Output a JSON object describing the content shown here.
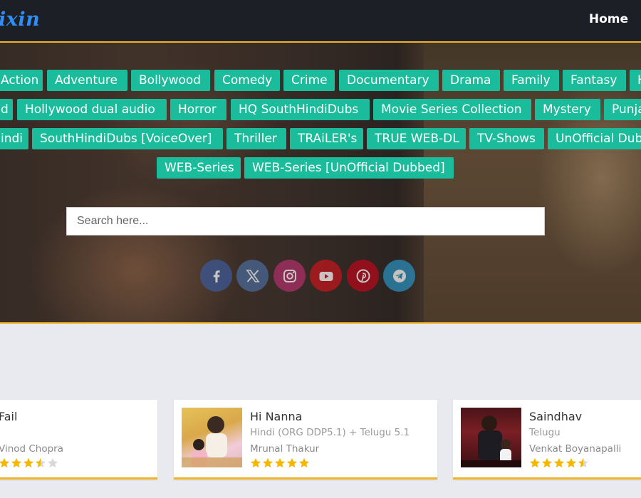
{
  "header": {
    "logo_text": "ixin",
    "nav_home": "Home"
  },
  "categories": {
    "row1": [
      "Action",
      "Adventure",
      "Bollywood",
      "Comedy",
      "Crime",
      "Documentary",
      "Drama",
      "Family",
      "Fantasy",
      "H"
    ],
    "row2": [
      "d",
      "Hollywood dual audio",
      "Horror",
      "HQ SouthHindiDubs",
      "Movie Series Collection",
      "Mystery",
      "Punja"
    ],
    "row3": [
      "indi",
      "SouthHindiDubs [VoiceOver]",
      "Thriller",
      "TRAiLER's",
      "TRUE WEB-DL",
      "TV-Shows",
      "UnOfficial Dub"
    ],
    "row4": [
      "WEB-Series",
      "WEB-Series [UnOfficial Dubbed]"
    ]
  },
  "search": {
    "placeholder": "Search here..."
  },
  "socials": {
    "items": [
      {
        "icon": "facebook-icon",
        "color": "#3b5998"
      },
      {
        "icon": "x-twitter-icon",
        "color": "#4a6a9a"
      },
      {
        "icon": "instagram-icon",
        "color": "#b0306a"
      },
      {
        "icon": "youtube-icon",
        "color": "#c4161c"
      },
      {
        "icon": "pinterest-icon",
        "color": "#b7081b"
      },
      {
        "icon": "telegram-icon",
        "color": "#2a8fbf"
      }
    ]
  },
  "movies": [
    {
      "title": "Fail",
      "language": "",
      "person": "Vinod Chopra",
      "rating": 3.5
    },
    {
      "title": "Hi Nanna",
      "language": "Hindi (ORG DDP5.1) + Telugu 5.1",
      "person": "Mrunal Thakur",
      "rating": 5
    },
    {
      "title": "Saindhav",
      "language": "Telugu",
      "person": "Venkat Boyanapalli",
      "rating": 4.5
    }
  ],
  "colors": {
    "accent": "#f0b429",
    "tag_bg": "#1abc9c",
    "logo": "#2f8ef5",
    "star": "#f5b800"
  }
}
